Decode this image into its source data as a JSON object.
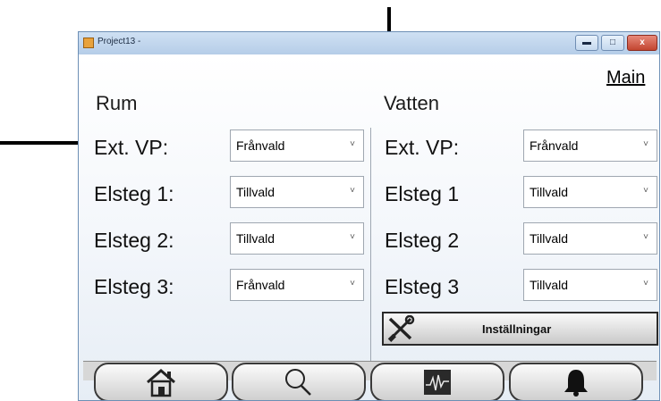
{
  "window": {
    "title": "Project13 -",
    "controls": {
      "minimize": "▬",
      "maximize": "□",
      "close": "x"
    }
  },
  "main_link": "Main",
  "sections": {
    "rum": {
      "title": "Rum",
      "rows": [
        {
          "label": "Ext. VP:",
          "value": "Frånvald"
        },
        {
          "label": "Elsteg 1:",
          "value": "Tillvald"
        },
        {
          "label": "Elsteg 2:",
          "value": "Tillvald"
        },
        {
          "label": "Elsteg 3:",
          "value": "Frånvald"
        }
      ]
    },
    "vatten": {
      "title": "Vatten",
      "rows": [
        {
          "label": "Ext. VP:",
          "value": "Frånvald"
        },
        {
          "label": "Elsteg 1",
          "value": "Tillvald"
        },
        {
          "label": "Elsteg 2",
          "value": "Tillvald"
        },
        {
          "label": "Elsteg 3",
          "value": "Tillvald"
        }
      ]
    }
  },
  "settings_button": {
    "label": "Inställningar",
    "icon": "tools-icon"
  },
  "nav": [
    {
      "icon": "home-icon"
    },
    {
      "icon": "search-icon"
    },
    {
      "icon": "chart-icon"
    },
    {
      "icon": "bell-icon"
    }
  ],
  "dropdown_arrow": "˅"
}
